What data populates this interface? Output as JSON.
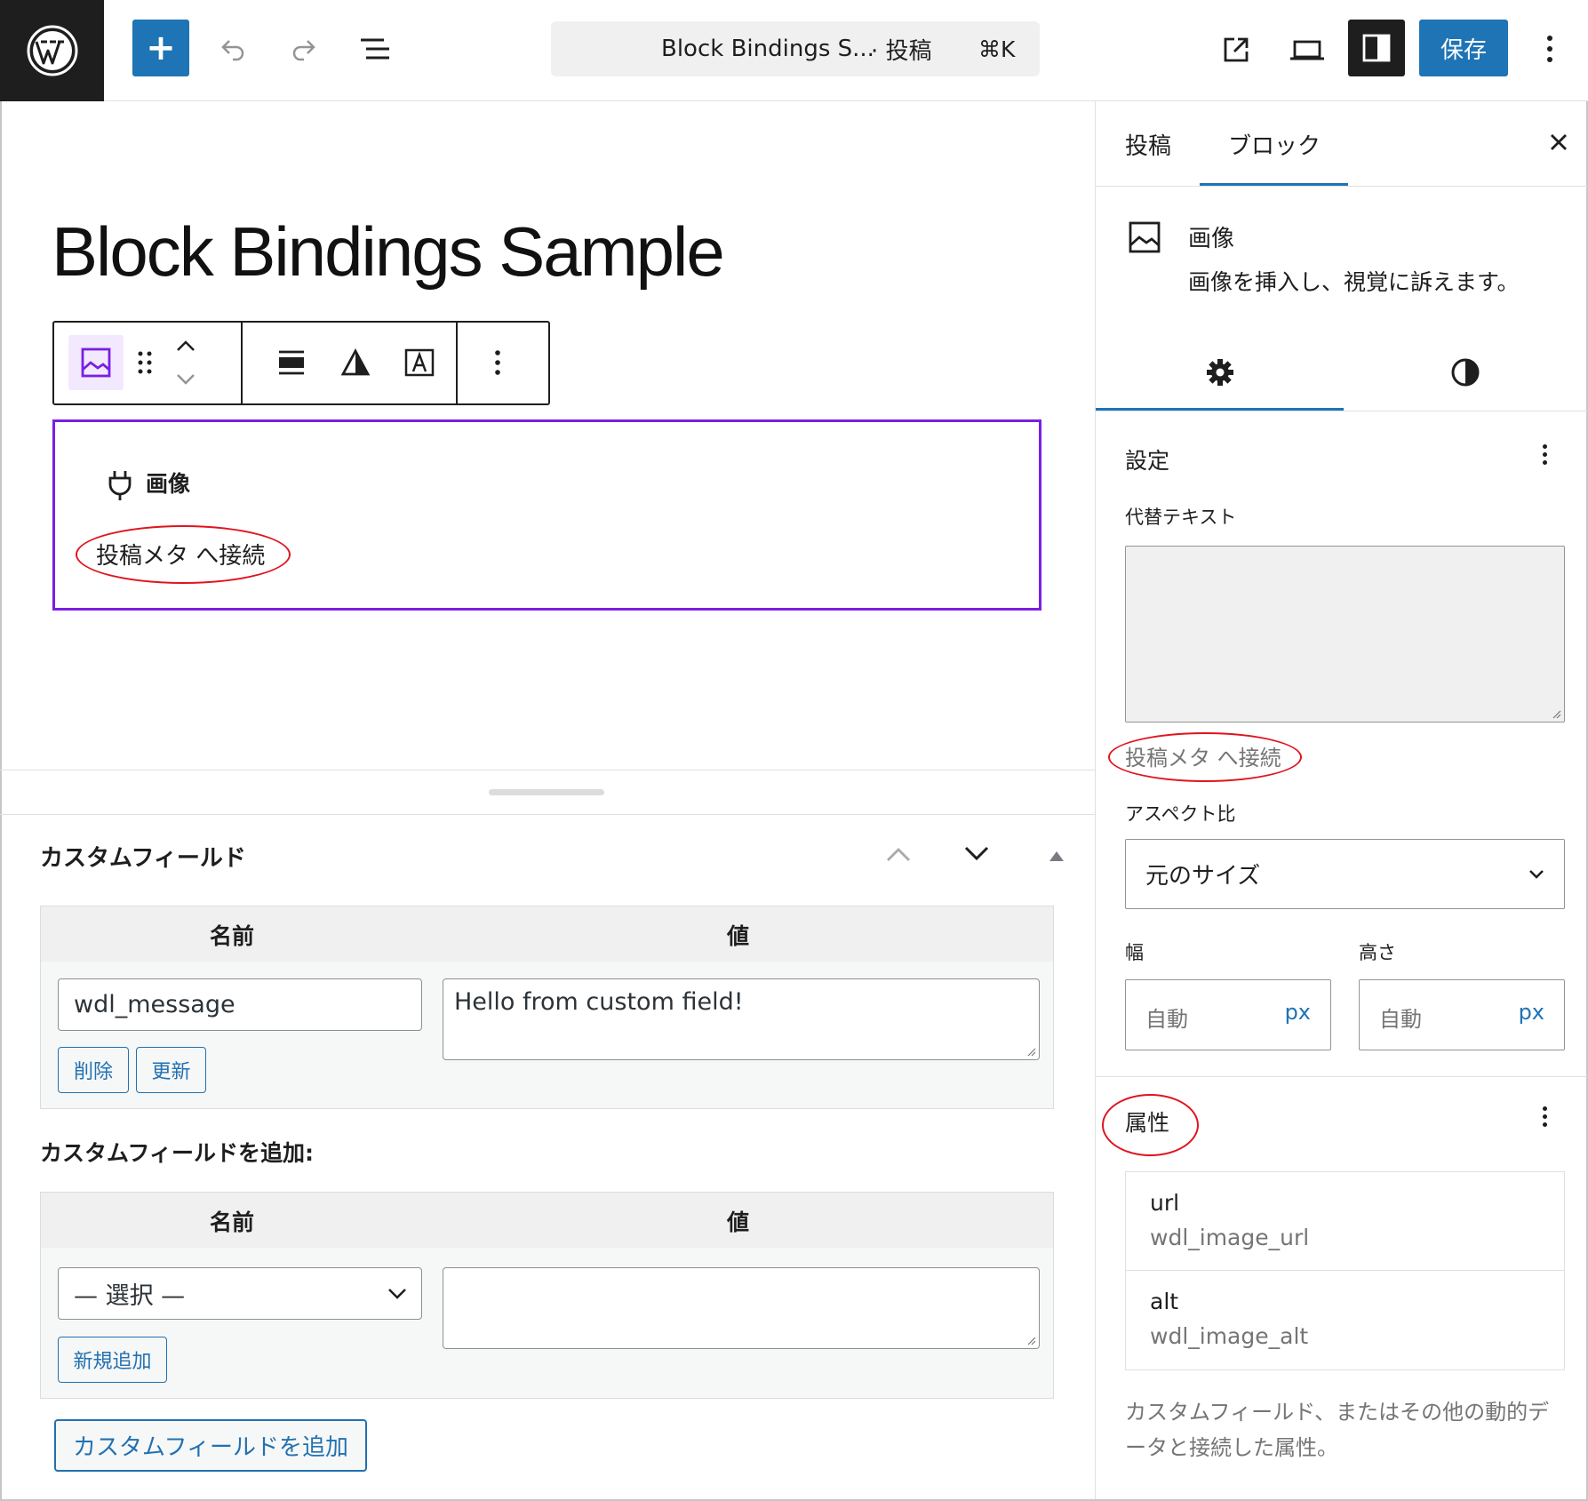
{
  "topbar": {
    "add_block_label": "+",
    "command_title": "Block Bindings S...",
    "command_post_type": "· 投稿",
    "command_shortcut": "⌘K",
    "save_label": "保存",
    "accent_color": "#1e74b5"
  },
  "canvas": {
    "post_title": "Block Bindings Sample",
    "placeholder_label": "画像",
    "placeholder_connect": "投稿メタ へ接続",
    "selection_color": "#7a1fe3"
  },
  "custom_fields": {
    "title": "カスタムフィールド",
    "header_name": "名前",
    "header_value": "値",
    "field_name": "wdl_message",
    "field_value": "Hello from custom field!",
    "delete_label": "削除",
    "update_label": "更新",
    "add_title": "カスタムフィールドを追加:",
    "add_header_name": "名前",
    "add_header_value": "値",
    "select_placeholder": "— 選択 —",
    "add_new_label": "新規追加",
    "add_button_label": "カスタムフィールドを追加"
  },
  "sidebar": {
    "tab_post": "投稿",
    "tab_block": "ブロック",
    "block_name": "画像",
    "block_description": "画像を挿入し、視覚に訴えます。",
    "settings_title": "設定",
    "alt_label": "代替テキスト",
    "alt_connect": "投稿メタ へ接続",
    "aspect_label": "アスペクト比",
    "aspect_value": "元のサイズ",
    "width_label": "幅",
    "height_label": "高さ",
    "width_placeholder": "自動",
    "height_placeholder": "自動",
    "unit": "px",
    "attributes_title": "属性",
    "attributes": [
      {
        "key": "url",
        "value": "wdl_image_url"
      },
      {
        "key": "alt",
        "value": "wdl_image_alt"
      }
    ],
    "attributes_help": "カスタムフィールド、またはその他の動的データと接続した属性。"
  },
  "annotation_color": "#e0141e"
}
